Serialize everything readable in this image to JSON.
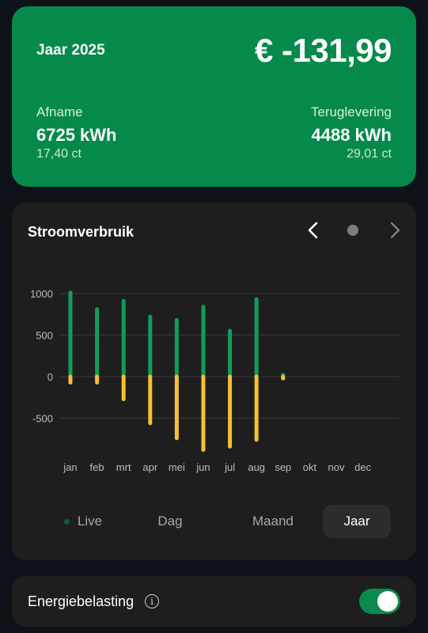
{
  "summary": {
    "year_label": "Jaar 2025",
    "total": "€ -131,99",
    "afname": {
      "label": "Afname",
      "kwh": "6725 kWh",
      "price": "17,40 ct"
    },
    "teruglevering": {
      "label": "Teruglevering",
      "kwh": "4488 kWh",
      "price": "29,01 ct"
    }
  },
  "chart_card": {
    "title": "Stroomverbruik",
    "prev_icon": "chevron-left-icon",
    "next_icon": "chevron-right-icon"
  },
  "chart_data": {
    "type": "bar",
    "categories": [
      "jan",
      "feb",
      "mrt",
      "apr",
      "mei",
      "jun",
      "jul",
      "aug",
      "sep",
      "okt",
      "nov",
      "dec"
    ],
    "series": [
      {
        "color": "#119e58",
        "values": [
          1030,
          830,
          930,
          740,
          700,
          860,
          570,
          950,
          40,
          0,
          0,
          0
        ]
      },
      {
        "color": "#f5c032",
        "values": [
          -90,
          -90,
          -290,
          -580,
          -760,
          -900,
          -860,
          -780,
          -40,
          0,
          0,
          0
        ]
      }
    ],
    "yticks": [
      1000,
      500,
      0,
      -500
    ],
    "ylim": [
      -950,
      1100
    ],
    "grid": true,
    "stacked": true
  },
  "periods": {
    "live": "Live",
    "dag": "Dag",
    "maand": "Maand",
    "jaar": "Jaar",
    "selected": "Jaar"
  },
  "tax": {
    "label": "Energiebelasting",
    "info_icon": "info-icon",
    "enabled": true
  },
  "colors": {
    "brand_green": "#068a4b",
    "consumption": "#119e58",
    "production": "#f5c032"
  }
}
